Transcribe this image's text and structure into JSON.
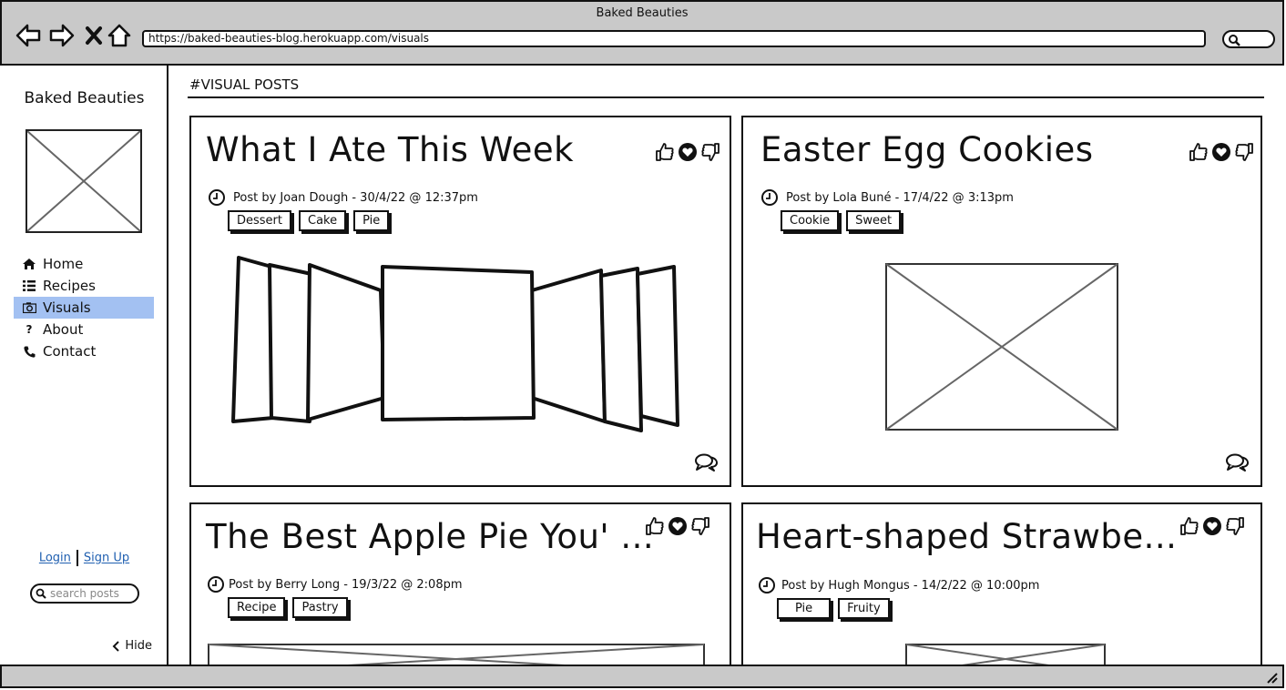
{
  "window": {
    "title": "Baked Beauties",
    "url": "https://baked-beauties-blog.herokuapp.com/visuals"
  },
  "icons": {
    "back": "back-arrow-icon",
    "forward": "forward-arrow-icon",
    "stop": "stop-icon",
    "home": "home-icon",
    "search": "search-icon",
    "like": "thumbs-up-icon",
    "love": "heart-icon",
    "dislike": "thumbs-down-icon",
    "comments": "comments-icon",
    "clock": "clock-icon"
  },
  "sidebar": {
    "brand": "Baked Beauties",
    "items": [
      {
        "label": "Home",
        "icon": "home-icon",
        "active": false
      },
      {
        "label": "Recipes",
        "icon": "list-icon",
        "active": false
      },
      {
        "label": "Visuals",
        "icon": "camera-icon",
        "active": true
      },
      {
        "label": "About",
        "icon": "question-icon",
        "active": false
      },
      {
        "label": "Contact",
        "icon": "phone-icon",
        "active": false
      }
    ],
    "login_label": "Login",
    "signup_label": "Sign Up",
    "search_placeholder": "search posts",
    "hide_label": "Hide"
  },
  "main": {
    "section_title": "#VISUAL POSTS",
    "posts": [
      {
        "title": "What I Ate This Week",
        "meta": "Post by Joan Dough - 30/4/22 @ 12:37pm",
        "tags": [
          "Dessert",
          "Cake",
          "Pie"
        ],
        "media": "carousel"
      },
      {
        "title": "Easter Egg Cookies",
        "meta": "Post by Lola Buné - 17/4/22 @ 3:13pm",
        "tags": [
          "Cookie",
          "Sweet"
        ],
        "media": "image"
      },
      {
        "title": "The Best Apple Pie You' ...",
        "meta": "Post by Berry Long - 19/3/22 @ 2:08pm",
        "tags": [
          "Recipe",
          "Pastry"
        ],
        "media": "image"
      },
      {
        "title": "Heart-shaped Strawbe...",
        "meta": "Post by Hugh Mongus - 14/2/22 @ 10:00pm",
        "tags": [
          "Pie",
          "Fruity"
        ],
        "media": "image"
      }
    ]
  },
  "colors": {
    "active_nav": "#a3c1f2",
    "chrome": "#c9c9c9",
    "link": "#1f5fb0"
  }
}
